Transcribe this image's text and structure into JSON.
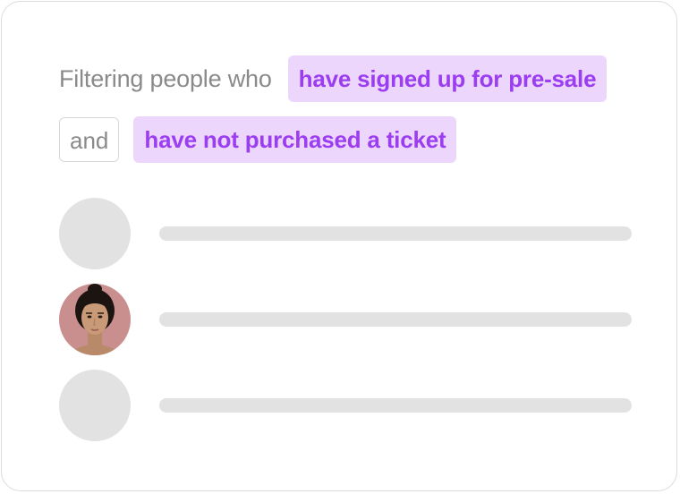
{
  "filter": {
    "lead_text": "Filtering people who",
    "condition_1": "have signed up for pre-sale",
    "conjunction": "and",
    "condition_2": "have not purchased a ticket"
  },
  "people": [
    {
      "avatar": "placeholder-avatar"
    },
    {
      "avatar": "person-photo"
    },
    {
      "avatar": "placeholder-avatar"
    }
  ],
  "colors": {
    "chip_bg": "#ecd6fb",
    "chip_text": "#9b3df0",
    "muted_text": "#8a8a8a",
    "placeholder": "#e2e2e2"
  }
}
